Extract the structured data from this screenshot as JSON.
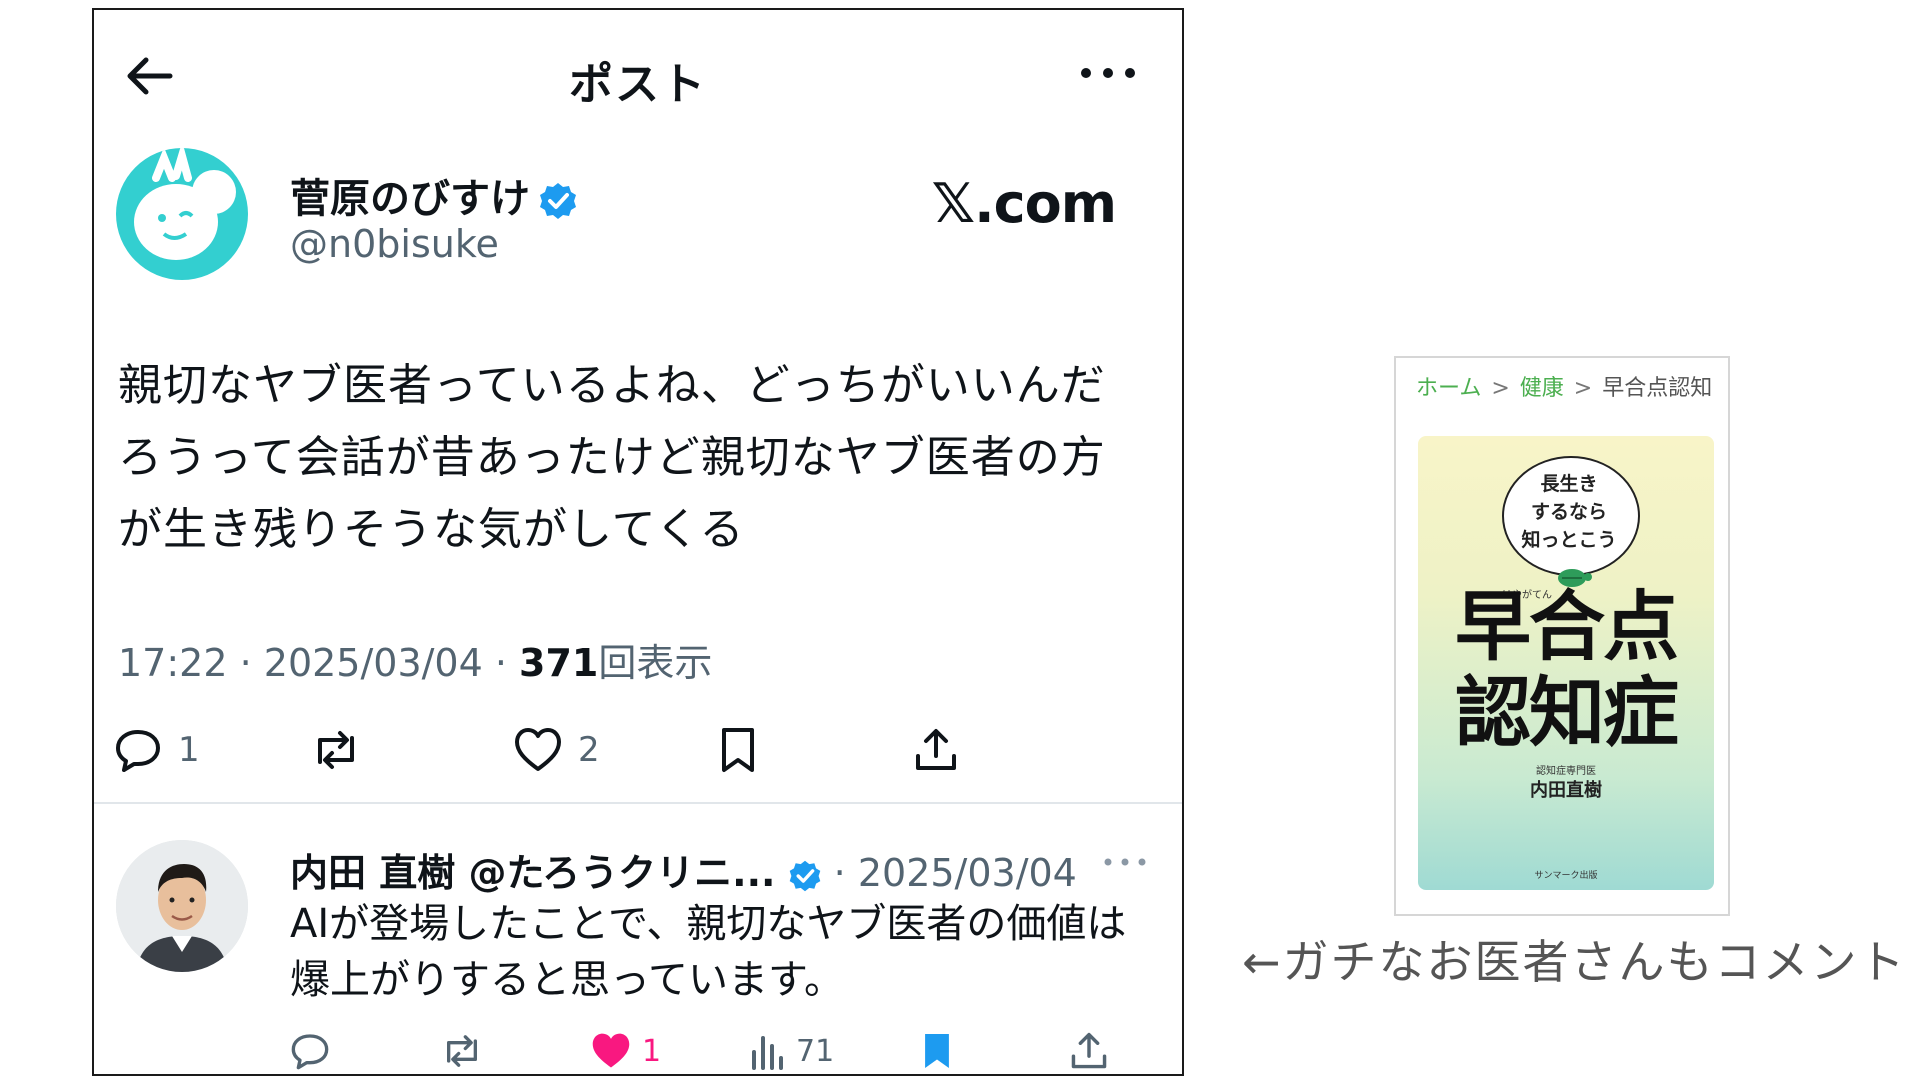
{
  "topbar": {
    "title": "ポスト"
  },
  "post": {
    "author_name": "菅原のびすけ",
    "handle": "@n0bisuke",
    "brand": "𝕏.com",
    "text_lines": [
      "親切なヤブ医者っているよね、どっちがいいんだ",
      "ろうって会話が昔あったけど親切なヤブ医者の方",
      "が生き残りそうな気がしてくる"
    ],
    "time": "17:22",
    "date": "2025/03/04",
    "views_count": "371",
    "views_label": "回表示",
    "reply_count": "1",
    "like_count": "2"
  },
  "reply": {
    "author_name": "内田 直樹 @たろうクリニ...",
    "date": "2025/03/04",
    "text_lines": [
      "AIが登場したことで、親切なヤブ医者の価値は",
      "爆上がりすると思っています。"
    ],
    "like_count": "1",
    "views_count": "71",
    "like_color": "#f91880",
    "bookmark_color": "#1d9bf0"
  },
  "book": {
    "breadcrumb": [
      "ホーム",
      "健康",
      "早合点認知"
    ],
    "bubble_lines": [
      "長生き",
      "するなら",
      "知っとこう"
    ],
    "ruby": "はやがてん",
    "title_lines": [
      "早合点",
      "認知症"
    ],
    "author_label": "認知症専門医",
    "author": "内田直樹",
    "publisher": "サンマーク出版"
  },
  "caption": "←ガチなお医者さんもコメント",
  "colors": {
    "verified": "#1d9bf0",
    "muted": "#536471",
    "avatar_teal": "#33cfd0"
  }
}
